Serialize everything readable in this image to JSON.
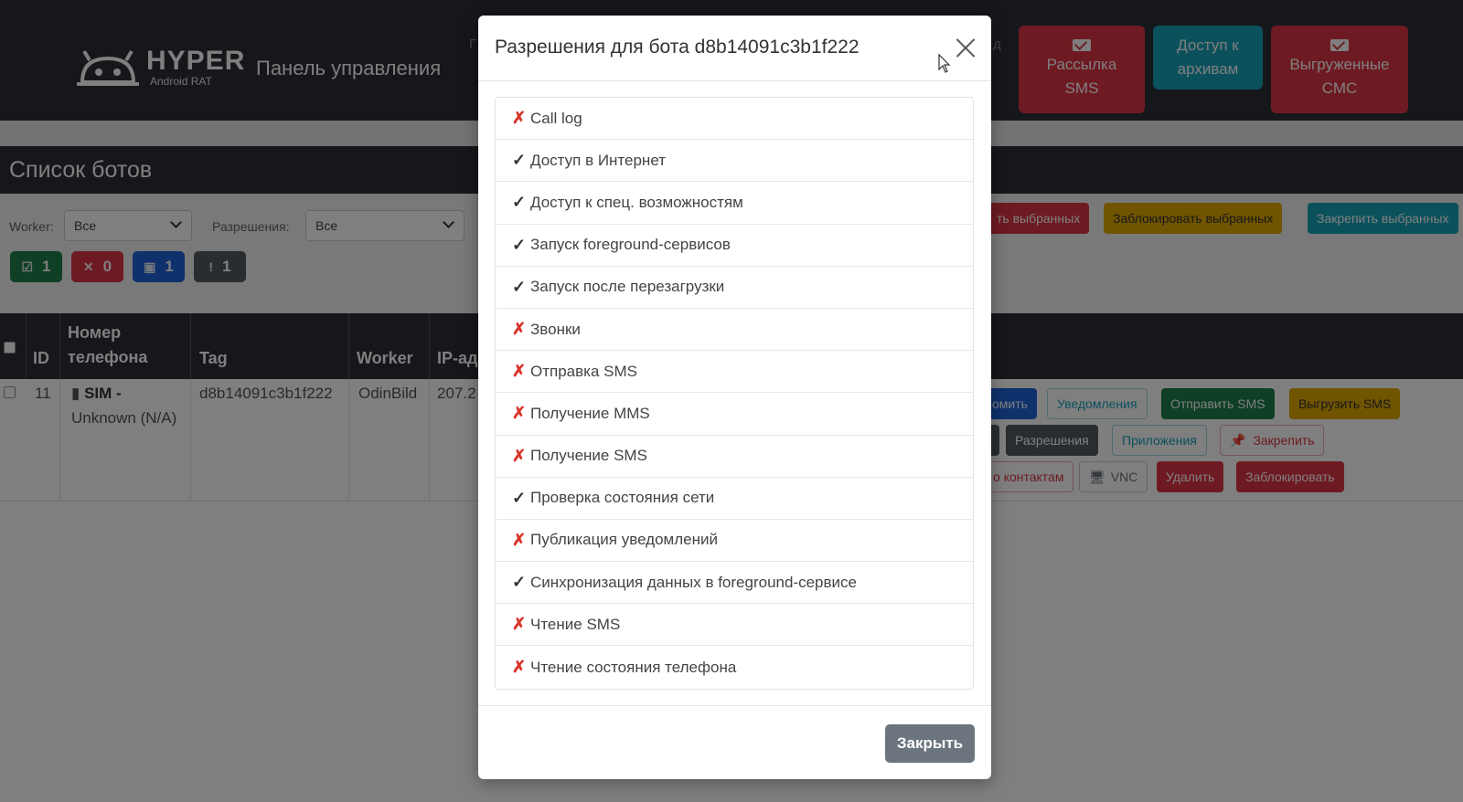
{
  "header": {
    "logo_text": "HYPER",
    "logo_sub": "Android RAT",
    "panel_title": "Панель управления",
    "nav_hint_left": "Г",
    "nav_hint_right": "д",
    "buttons": [
      {
        "label_line1": "Рассылка",
        "label_line2": "SMS",
        "color": "#dc3545"
      },
      {
        "label_line1": "Доступ к",
        "label_line2": "архивам",
        "color": "#17a2b8"
      },
      {
        "label_line1": "Выгруженные",
        "label_line2": "СМС",
        "color": "#dc3545"
      }
    ]
  },
  "bots_list": {
    "title": "Список ботов",
    "filters": {
      "worker_label": "Worker:",
      "worker_value": "Все",
      "permissions_label": "Разрешения:",
      "permissions_value": "Все"
    },
    "counters": [
      {
        "icon": "☑",
        "value": "1",
        "color": "#1e7e4a"
      },
      {
        "icon": "✕",
        "value": "0",
        "color": "#dc3545"
      },
      {
        "icon": "▣",
        "value": "1",
        "color": "#1f62d8"
      },
      {
        "icon": "!",
        "value": "1",
        "color": "#555a60"
      }
    ],
    "bulk_actions": [
      {
        "label": "ть выбранных",
        "color": "#dc3545"
      },
      {
        "label": "Заблокировать выбранных",
        "color": "#e0a800"
      },
      {
        "label": "Закрепить выбранных",
        "color": "#17a2b8"
      }
    ],
    "table": {
      "headers": {
        "id": "ID",
        "phone_line1": "Номер",
        "phone_line2": "телефона",
        "tag": "Tag",
        "worker": "Worker",
        "ip": "IP-ад"
      },
      "row": {
        "id": "11",
        "sim_label": "SIM -",
        "sim_status": "Unknown (N/A)",
        "tag": "d8b14091c3b1f222",
        "worker": "OdinBild",
        "ip": "207.2"
      }
    },
    "row_actions": {
      "row1": [
        {
          "label": "омить",
          "style": "primary"
        },
        {
          "label": "Уведомления",
          "style": "outline-info"
        },
        {
          "label": "Отправить SMS",
          "style": "success"
        },
        {
          "label": "Выгрузить SMS",
          "style": "warning"
        }
      ],
      "row2": [
        {
          "label": "Разрешения",
          "style": "secondary"
        },
        {
          "label": "Приложения",
          "style": "outline-info"
        },
        {
          "label": "Закрепить",
          "style": "outline-danger"
        }
      ],
      "row3": [
        {
          "label": "о контактам",
          "style": "outline-danger"
        },
        {
          "label": "VNC",
          "style": "outline"
        },
        {
          "label": "Удалить",
          "style": "danger"
        },
        {
          "label": "Заблокировать",
          "style": "danger"
        }
      ]
    }
  },
  "modal": {
    "title": "Разрешения для бота d8b14091c3b1f222",
    "close_label": "Закрыть",
    "permissions": [
      {
        "granted": false,
        "mark": "✗",
        "name": "Call log"
      },
      {
        "granted": true,
        "mark": "✓",
        "name": "Доступ в Интернет"
      },
      {
        "granted": true,
        "mark": "✓",
        "name": "Доступ к спец. возможностям"
      },
      {
        "granted": true,
        "mark": "✓",
        "name": "Запуск foreground-сервисов"
      },
      {
        "granted": true,
        "mark": "✓",
        "name": "Запуск после перезагрузки"
      },
      {
        "granted": false,
        "mark": "✗",
        "name": "Звонки"
      },
      {
        "granted": false,
        "mark": "✗",
        "name": "Отправка SMS"
      },
      {
        "granted": false,
        "mark": "✗",
        "name": "Получение MMS"
      },
      {
        "granted": false,
        "mark": "✗",
        "name": "Получение SMS"
      },
      {
        "granted": true,
        "mark": "✓",
        "name": "Проверка состояния сети"
      },
      {
        "granted": false,
        "mark": "✗",
        "name": "Публикация уведомлений"
      },
      {
        "granted": true,
        "mark": "✓",
        "name": "Синхронизация данных в foreground-сервисе"
      },
      {
        "granted": false,
        "mark": "✗",
        "name": "Чтение SMS"
      },
      {
        "granted": false,
        "mark": "✗",
        "name": "Чтение состояния телефона"
      }
    ]
  }
}
